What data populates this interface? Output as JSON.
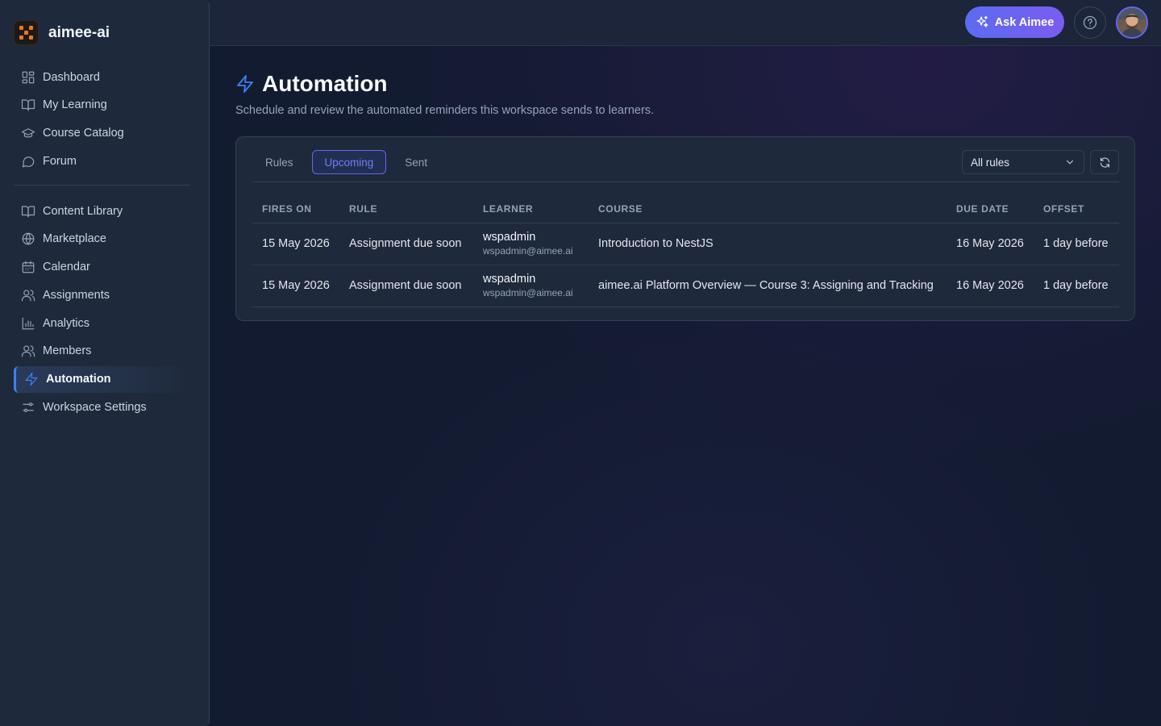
{
  "brand": {
    "name": "aimee-ai"
  },
  "sidebar": {
    "primary": [
      {
        "label": "Dashboard",
        "icon": "dashboard-icon"
      },
      {
        "label": "My Learning",
        "icon": "book-open-icon"
      },
      {
        "label": "Course Catalog",
        "icon": "graduation-cap-icon"
      },
      {
        "label": "Forum",
        "icon": "chat-bubble-icon"
      }
    ],
    "secondary": [
      {
        "label": "Content Library",
        "icon": "book-open-icon"
      },
      {
        "label": "Marketplace",
        "icon": "globe-icon"
      },
      {
        "label": "Calendar",
        "icon": "calendar-icon"
      },
      {
        "label": "Assignments",
        "icon": "users-icon"
      },
      {
        "label": "Analytics",
        "icon": "bar-chart-icon"
      },
      {
        "label": "Members",
        "icon": "users-icon"
      },
      {
        "label": "Automation",
        "icon": "lightning-icon",
        "active": true
      },
      {
        "label": "Workspace Settings",
        "icon": "sliders-icon"
      }
    ]
  },
  "topbar": {
    "ask_label": "Ask Aimee",
    "ask_icon": "sparkles-icon",
    "help_icon": "help-circle-icon"
  },
  "page": {
    "title": "Automation",
    "subtitle": "Schedule and review the automated reminders this workspace sends to learners."
  },
  "tabs": [
    {
      "label": "Rules"
    },
    {
      "label": "Upcoming",
      "active": true
    },
    {
      "label": "Sent"
    }
  ],
  "filter": {
    "selected": "All rules"
  },
  "table": {
    "headers": [
      "FIRES ON",
      "RULE",
      "LEARNER",
      "COURSE",
      "DUE DATE",
      "OFFSET"
    ],
    "rows": [
      {
        "fires_on": "15 May 2026",
        "rule": "Assignment due soon",
        "learner_name": "wspadmin",
        "learner_email": "wspadmin@aimee.ai",
        "course": "Introduction to NestJS",
        "due_date": "16 May 2026",
        "offset": "1 day before"
      },
      {
        "fires_on": "15 May 2026",
        "rule": "Assignment due soon",
        "learner_name": "wspadmin",
        "learner_email": "wspadmin@aimee.ai",
        "course": "aimee.ai Platform Overview — Course 3: Assigning and Tracking",
        "due_date": "16 May 2026",
        "offset": "1 day before"
      }
    ]
  },
  "colors": {
    "accent": "#3b82f6",
    "ask_gradient_start": "#5b6cf0",
    "ask_gradient_end": "#7a5cf0",
    "tab_active": "#6366f1",
    "logo_accent": "#f97316"
  }
}
